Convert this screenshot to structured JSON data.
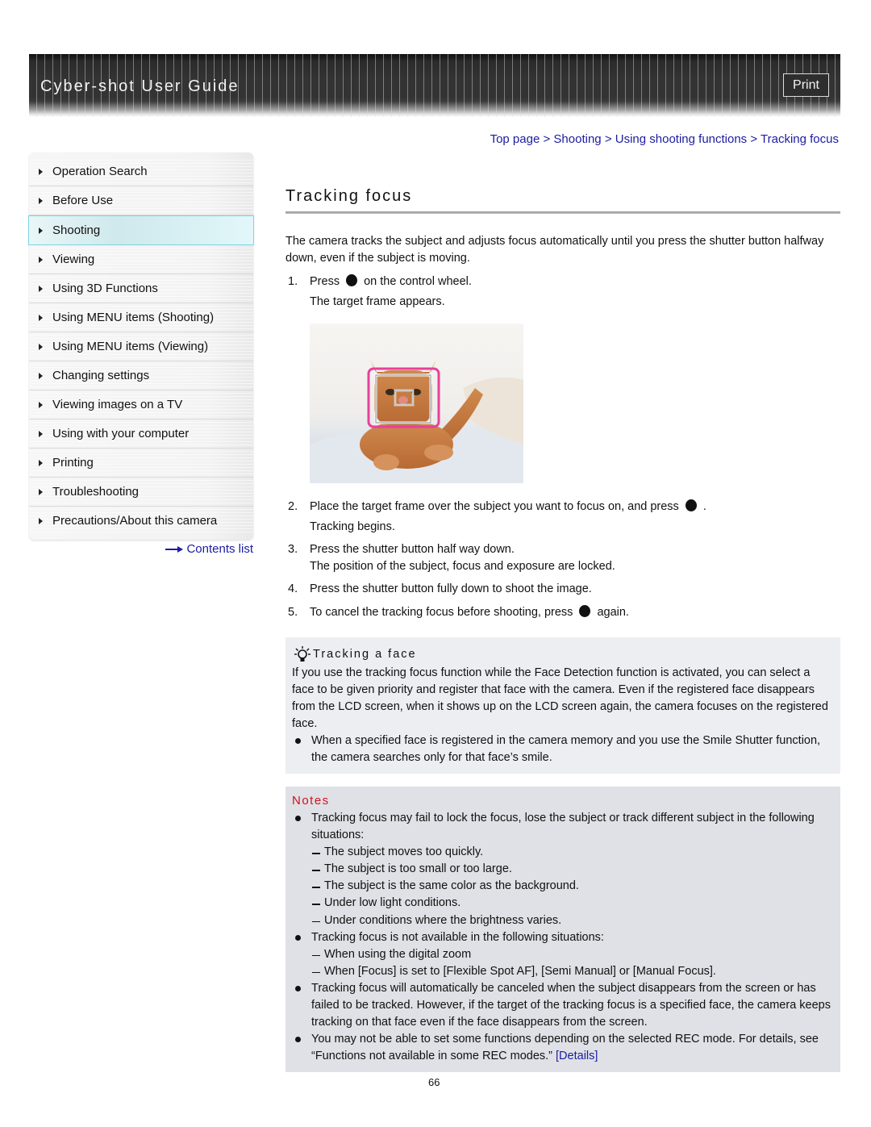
{
  "header": {
    "title": "Cyber-shot User Guide",
    "print_label": "Print"
  },
  "sidebar": {
    "items": [
      {
        "label": "Operation Search",
        "active": false
      },
      {
        "label": "Before Use",
        "active": false
      },
      {
        "label": "Shooting",
        "active": true
      },
      {
        "label": "Viewing",
        "active": false
      },
      {
        "label": "Using 3D Functions",
        "active": false
      },
      {
        "label": "Using MENU items (Shooting)",
        "active": false
      },
      {
        "label": "Using MENU items (Viewing)",
        "active": false
      },
      {
        "label": "Changing settings",
        "active": false
      },
      {
        "label": "Viewing images on a TV",
        "active": false
      },
      {
        "label": "Using with your computer",
        "active": false
      },
      {
        "label": "Printing",
        "active": false
      },
      {
        "label": "Troubleshooting",
        "active": false
      },
      {
        "label": "Precautions/About this camera",
        "active": false
      }
    ],
    "contents_link": "Contents list"
  },
  "breadcrumb": {
    "items": [
      "Top page",
      "Shooting",
      "Using shooting functions",
      "Tracking focus"
    ],
    "separator": ">"
  },
  "page": {
    "title": "Tracking focus",
    "intro": "The camera tracks the subject and adjusts focus automatically until you press the shutter button halfway down, even if the subject is moving.",
    "steps": [
      {
        "num": "1.",
        "before": "Press",
        "icon": "center-button-icon",
        "after": "on the control wheel.",
        "sub": "The target frame appears."
      },
      {
        "num": "2.",
        "before": "Place the target frame over the subject you want to focus on, and press",
        "icon": "center-button-icon",
        "after": ".",
        "sub": "Tracking begins."
      },
      {
        "num": "3.",
        "text": "Press the shutter button half way down.",
        "sub": "The position of the subject, focus and exposure are locked."
      },
      {
        "num": "4.",
        "text": "Press the shutter button fully down to shoot the image."
      },
      {
        "num": "5.",
        "before": "To cancel the tracking focus before shooting, press",
        "icon": "center-button-icon",
        "after": "again."
      }
    ],
    "figure_alt": "Kitten on a blanket with tracking target frame on its face",
    "figure_colors": {
      "frame": "#e8409a",
      "inner_frame": "#ffffff"
    }
  },
  "tip": {
    "title": "Tracking a face",
    "text": "If you use the tracking focus function while the Face Detection function is activated, you can select a face to be given priority and register that face with the camera. Even if the registered face disappears from the LCD screen, when it shows up on the LCD screen again, the camera focuses on the registered face.",
    "bullets": [
      "When a specified face is registered in the camera memory and you use the Smile Shutter function, the camera searches only for that face’s smile."
    ]
  },
  "notes": {
    "title": "Notes",
    "title_color": "#d0121b",
    "items": [
      {
        "text": "Tracking focus may fail to lock the focus, lose the subject or track different subject in the following situations:",
        "subs": [
          "The subject moves too quickly.",
          "The subject is too small or too large.",
          "The subject is the same color as the background.",
          "Under low light conditions.",
          "Under conditions where the brightness varies."
        ]
      },
      {
        "text": "Tracking focus is not available in the following situations:",
        "subs": [
          "When using the digital zoom",
          "When [Focus] is set to [Flexible Spot AF], [Semi Manual] or [Manual Focus]."
        ]
      },
      {
        "text": "Tracking focus will automatically be canceled when the subject disappears from the screen or has failed to be tracked. However, if the target of the tracking focus is a specified face, the camera keeps tracking on that face even if the face disappears from the screen.",
        "subs": []
      },
      {
        "text": "You may not be able to set some functions depending on the selected REC mode. For details, see “Functions not available in some REC modes.”",
        "link": "[Details]",
        "subs": []
      }
    ]
  },
  "footer": {
    "page_number": "66"
  }
}
